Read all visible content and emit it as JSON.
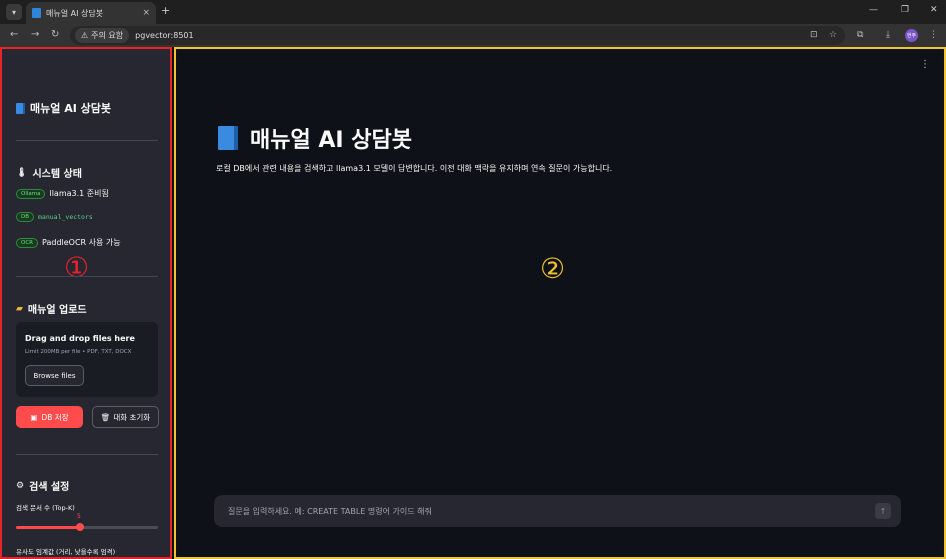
{
  "browser": {
    "tab_title": "매뉴얼 AI 상담봇",
    "tab_close": "×",
    "new_tab": "+",
    "security_warning": "주의 요함",
    "url": "pgvector:8501",
    "profile_initial": "현주"
  },
  "sidebar": {
    "app_title": "매뉴얼 AI 상담봇",
    "system_status_title": "시스템 상태",
    "status_items": [
      {
        "badge": "Ollama",
        "text": "llama3.1 준비됨"
      },
      {
        "badge": "DB",
        "text": "manual_vectors"
      },
      {
        "badge": "OCR",
        "text": "PaddleOCR 사용 가능"
      }
    ],
    "annotation": "①",
    "upload_title": "매뉴얼 업로드",
    "uploader": {
      "title": "Drag and drop files here",
      "limit": "Limit 200MB per file • PDF, TXT, DOCX",
      "browse_label": "Browse files"
    },
    "save_label": "DB 저장",
    "reset_label": "대화 초기화",
    "search_settings_title": "검색 설정",
    "topk_label": "검색 문서 수 (Top-K)",
    "topk_value": "5",
    "topk_fraction": 0.45,
    "threshold_label": "유사도 임계값 (거리, 낮을수록 엄격)"
  },
  "main": {
    "title": "매뉴얼 AI 상담봇",
    "description": "로컬 DB에서 관련 내용을 검색하고 llama3.1 모델이 답변합니다. 이전 대화 맥락을 유지하며 연속 질문이 가능합니다.",
    "annotation": "②",
    "chat_placeholder": "질문을 입력하세요. 예: CREATE TABLE 명령어 가이드 해줘"
  },
  "colors": {
    "accent": "#ff4b4b",
    "sidebar_outline": "#e8232a",
    "main_outline": "#f2c230",
    "status_green": "#6fdc82"
  }
}
